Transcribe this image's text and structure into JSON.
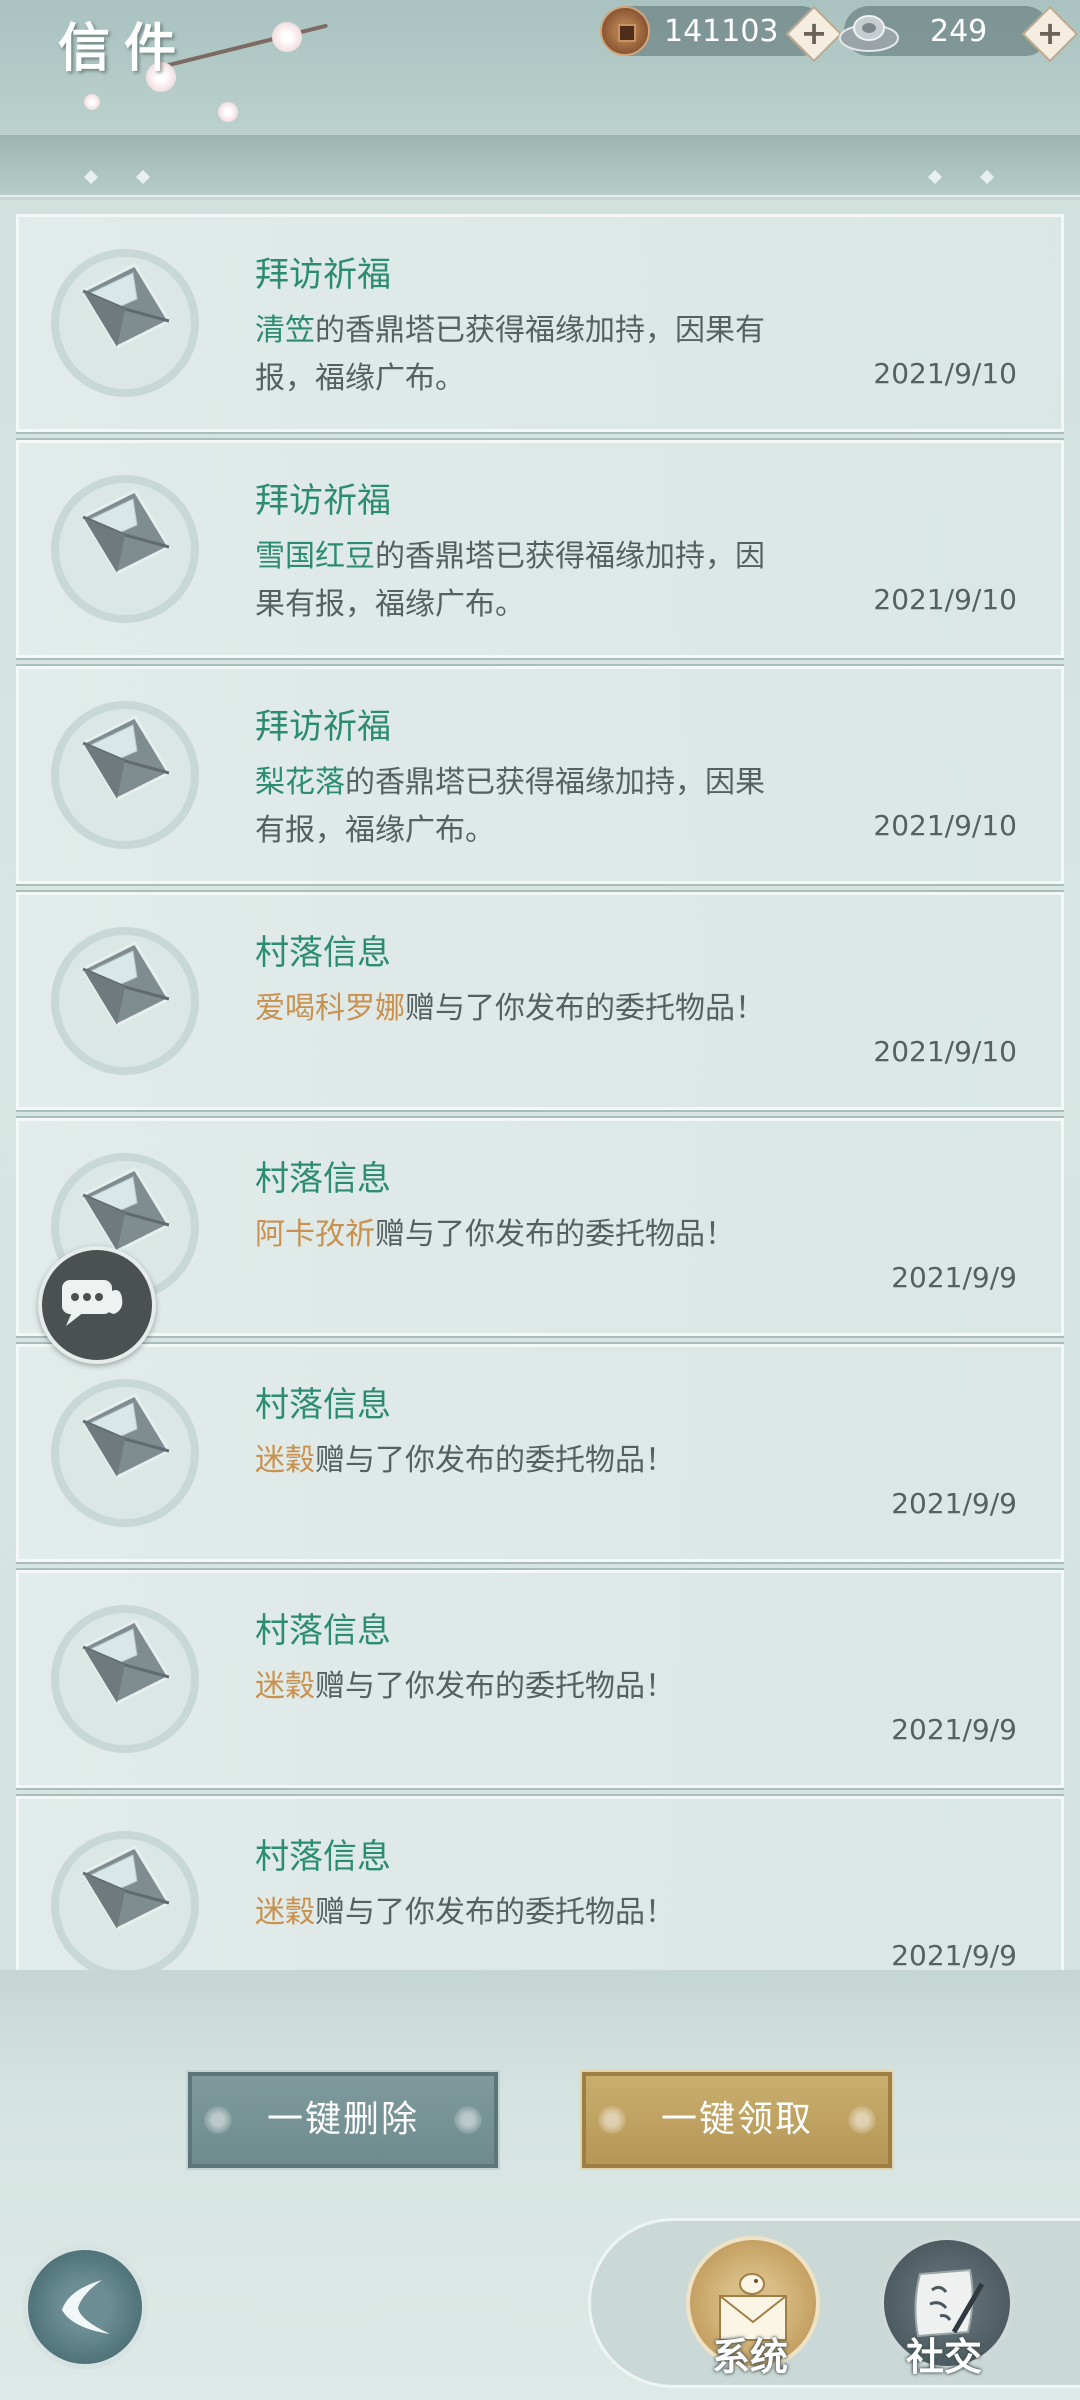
{
  "header": {
    "title": "信件",
    "copper": "141103",
    "silver": "249"
  },
  "mails": [
    {
      "title": "拜访祈福",
      "name": "清笠",
      "name_style": "green",
      "body_line1": "的香鼎塔已获得福缘加持，因果有",
      "body_line2": "报，福缘广布。",
      "date": "2021/9/10"
    },
    {
      "title": "拜访祈福",
      "name": "雪国红豆",
      "name_style": "green",
      "body_line1": "的香鼎塔已获得福缘加持，因",
      "body_line2": "果有报，福缘广布。",
      "date": "2021/9/10"
    },
    {
      "title": "拜访祈福",
      "name": "梨花落",
      "name_style": "green",
      "body_line1": "的香鼎塔已获得福缘加持，因果",
      "body_line2": "有报，福缘广布。",
      "date": "2021/9/10"
    },
    {
      "title": "村落信息",
      "name": "爱喝科罗娜",
      "name_style": "gold",
      "body_line1": "赠与了你发布的委托物品！",
      "body_line2": "",
      "date": "2021/9/10"
    },
    {
      "title": "村落信息",
      "name": "阿卡孜祈",
      "name_style": "gold",
      "body_line1": "赠与了你发布的委托物品！",
      "body_line2": "",
      "date": "2021/9/9"
    },
    {
      "title": "村落信息",
      "name": "迷穀",
      "name_style": "gold",
      "body_line1": "赠与了你发布的委托物品！",
      "body_line2": "",
      "date": "2021/9/9"
    },
    {
      "title": "村落信息",
      "name": "迷穀",
      "name_style": "gold",
      "body_line1": "赠与了你发布的委托物品！",
      "body_line2": "",
      "date": "2021/9/9"
    },
    {
      "title": "村落信息",
      "name": "迷穀",
      "name_style": "gold",
      "body_line1": "赠与了你发布的委托物品！",
      "body_line2": "",
      "date": "2021/9/9"
    }
  ],
  "actions": {
    "delete_all": "一键删除",
    "claim_all": "一键领取"
  },
  "tabs": {
    "system": "系统",
    "social": "社交"
  },
  "colors": {
    "name_green": "#2b8c72",
    "name_gold": "#c8914f",
    "claim_button": "#c9ae6e",
    "delete_button": "#7e9a9c"
  }
}
